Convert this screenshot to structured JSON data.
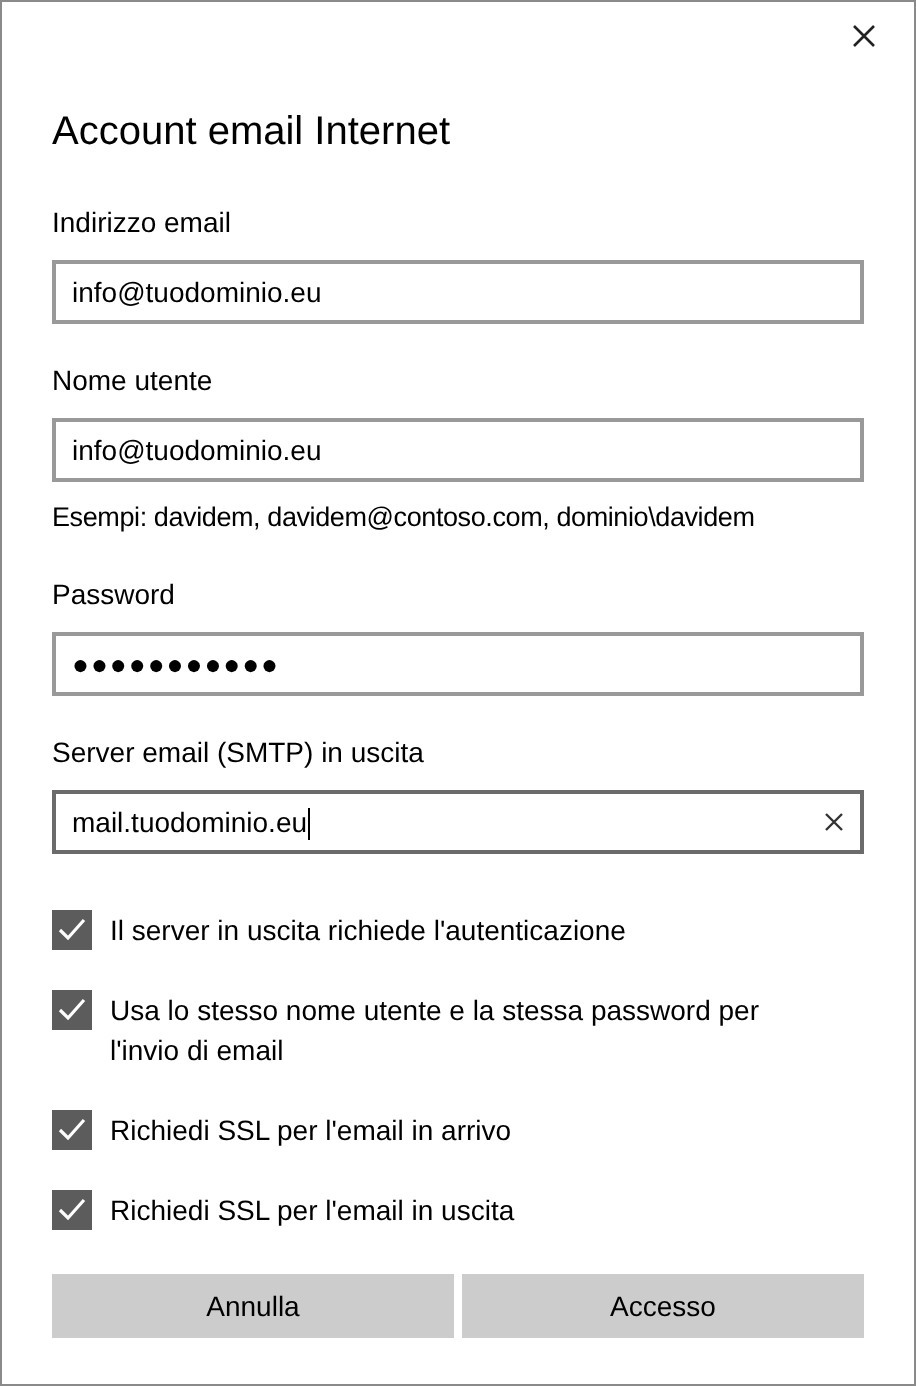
{
  "dialog": {
    "title": "Account email Internet"
  },
  "fields": [
    {
      "label": "Indirizzo email",
      "value": "info@tuodominio.eu",
      "focused": false
    },
    {
      "label": "Nome utente",
      "value": "info@tuodominio.eu",
      "focused": false,
      "hint": "Esempi: davidem, davidem@contoso.com, dominio\\davidem"
    },
    {
      "label": "Password",
      "value": "●●●●●●●●●●●",
      "focused": false
    },
    {
      "label": "Server email (SMTP) in uscita",
      "value": "mail.tuodominio.eu",
      "focused": true
    }
  ],
  "options": [
    {
      "label": "Il server in uscita richiede l'autenticazione",
      "checked": true
    },
    {
      "label": "Usa lo stesso nome utente e la stessa password per l'invio di email",
      "checked": true
    },
    {
      "label": "Richiedi SSL per l'email in arrivo",
      "checked": true
    },
    {
      "label": "Richiedi SSL per l'email in uscita",
      "checked": true
    }
  ],
  "buttons": [
    "Annulla",
    "Accesso"
  ]
}
